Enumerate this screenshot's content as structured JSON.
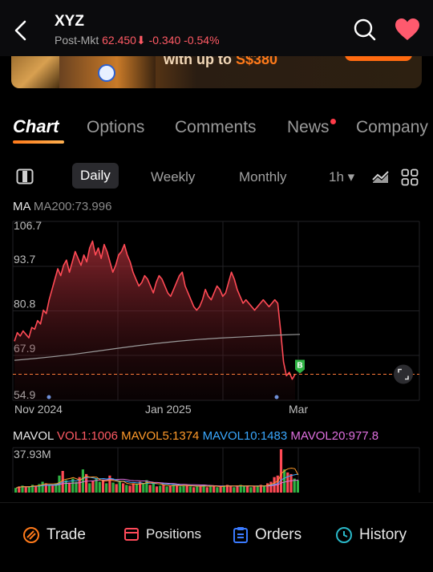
{
  "header": {
    "ticker": "XYZ",
    "post_label": "Post-Mkt",
    "post_price": "62.450",
    "post_arrow": "⬇",
    "post_change": "-0.340",
    "post_change_pct": "-0.54%"
  },
  "banner": {
    "text_prefix": "with up to",
    "text_amount": "S$380"
  },
  "tabs": [
    "Chart",
    "Options",
    "Comments",
    "News",
    "Company"
  ],
  "periods": {
    "items": [
      "Daily",
      "Weekly",
      "Monthly",
      "1h ▾"
    ],
    "active": "Daily"
  },
  "ma": {
    "label": "MA",
    "value": "MA200:73.996"
  },
  "chart_data": [
    {
      "type": "area",
      "y_ticks": [
        "106.7",
        "93.7",
        "80.8",
        "67.9",
        "54.9"
      ],
      "x_ticks": [
        "Nov 2024",
        "Jan 2025",
        "Mar"
      ],
      "ylim": [
        54.9,
        106.7
      ],
      "last_price": 62.45,
      "price_series": [
        72,
        74.5,
        73.5,
        75,
        74,
        73,
        76,
        75.5,
        78,
        77,
        81,
        80,
        84,
        87,
        90,
        93,
        91,
        94,
        95.5,
        92,
        95,
        98,
        96,
        94,
        97,
        95,
        99,
        101,
        97,
        99,
        96,
        100,
        98,
        95,
        92,
        94,
        97,
        98,
        100,
        97,
        95,
        92,
        90,
        88,
        89,
        91,
        90,
        88,
        86,
        89,
        91,
        90,
        88,
        86,
        85,
        87,
        89,
        91,
        92,
        88,
        86,
        84,
        82,
        81,
        82,
        84,
        87,
        85,
        84,
        86,
        88,
        87,
        85,
        86,
        89,
        92,
        90,
        87,
        85,
        83,
        84,
        83,
        82,
        81,
        82,
        83,
        84,
        83,
        82,
        83,
        84,
        83,
        75,
        66,
        62,
        63,
        61,
        62.45
      ],
      "ma200_series": [
        66.5,
        67.0,
        67.6,
        68.3,
        69.1,
        69.9,
        70.7,
        71.4,
        72.0,
        72.5,
        72.9,
        73.2,
        73.5,
        73.8,
        74.0
      ],
      "markers": [
        {
          "label": "B",
          "color": "#2fb344"
        }
      ]
    },
    {
      "type": "bar",
      "title": "MAVOL",
      "top_label": "37.93M",
      "series": [
        {
          "name": "VOL1:1006",
          "color": "#ff5a64"
        },
        {
          "name": "MAVOL5:1374",
          "color": "#ff9a2a"
        },
        {
          "name": "MAVOL10:1483",
          "color": "#3aa8ff"
        },
        {
          "name": "MAVOL20:977.8",
          "color": "#e070e0"
        }
      ],
      "volumes": [
        6,
        8,
        9,
        7,
        8,
        10,
        9,
        11,
        14,
        12,
        10,
        9,
        12,
        22,
        28,
        16,
        13,
        18,
        14,
        20,
        30,
        24,
        12,
        15,
        18,
        14,
        16,
        12,
        22,
        13,
        11,
        14,
        12,
        10,
        9,
        12,
        11,
        14,
        12,
        16,
        10,
        12,
        8,
        9,
        10,
        8,
        9,
        10,
        9,
        8,
        10,
        9,
        8,
        7,
        8,
        9,
        10,
        7,
        8,
        9,
        7,
        8,
        9,
        10,
        8,
        7,
        9,
        10,
        8,
        9,
        7,
        8,
        9,
        10,
        8,
        12,
        14,
        20,
        22,
        56,
        30,
        26,
        24,
        18,
        16
      ],
      "up": [
        1,
        0,
        1,
        0,
        1,
        1,
        0,
        1,
        1,
        0,
        1,
        0,
        1,
        1,
        0,
        1,
        0,
        1,
        1,
        0,
        1,
        0,
        1,
        0,
        1,
        1,
        0,
        1,
        0,
        1,
        0,
        1,
        0,
        1,
        0,
        0,
        1,
        0,
        1,
        1,
        0,
        1,
        0,
        1,
        0,
        1,
        0,
        1,
        0,
        1,
        1,
        0,
        1,
        0,
        1,
        0,
        1,
        0,
        1,
        0,
        1,
        0,
        1,
        0,
        0,
        1,
        0,
        1,
        1,
        0,
        1,
        0,
        1,
        0,
        1,
        0,
        0,
        0,
        0,
        0,
        1,
        0,
        0,
        1,
        1
      ]
    }
  ],
  "bottom_nav": [
    "Trade",
    "Positions",
    "Orders",
    "History"
  ]
}
